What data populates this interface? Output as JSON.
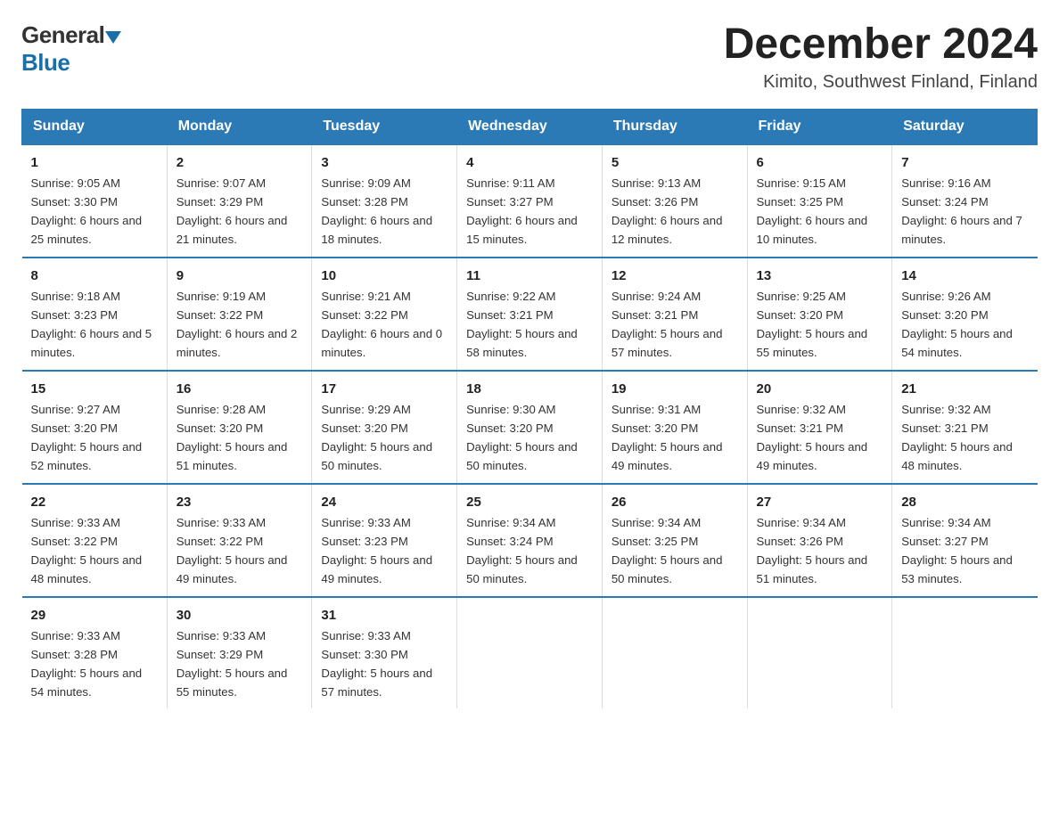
{
  "header": {
    "logo_general": "General",
    "logo_blue": "Blue",
    "title": "December 2024",
    "subtitle": "Kimito, Southwest Finland, Finland"
  },
  "days_of_week": [
    "Sunday",
    "Monday",
    "Tuesday",
    "Wednesday",
    "Thursday",
    "Friday",
    "Saturday"
  ],
  "weeks": [
    [
      {
        "num": "1",
        "sunrise": "9:05 AM",
        "sunset": "3:30 PM",
        "daylight": "6 hours and 25 minutes."
      },
      {
        "num": "2",
        "sunrise": "9:07 AM",
        "sunset": "3:29 PM",
        "daylight": "6 hours and 21 minutes."
      },
      {
        "num": "3",
        "sunrise": "9:09 AM",
        "sunset": "3:28 PM",
        "daylight": "6 hours and 18 minutes."
      },
      {
        "num": "4",
        "sunrise": "9:11 AM",
        "sunset": "3:27 PM",
        "daylight": "6 hours and 15 minutes."
      },
      {
        "num": "5",
        "sunrise": "9:13 AM",
        "sunset": "3:26 PM",
        "daylight": "6 hours and 12 minutes."
      },
      {
        "num": "6",
        "sunrise": "9:15 AM",
        "sunset": "3:25 PM",
        "daylight": "6 hours and 10 minutes."
      },
      {
        "num": "7",
        "sunrise": "9:16 AM",
        "sunset": "3:24 PM",
        "daylight": "6 hours and 7 minutes."
      }
    ],
    [
      {
        "num": "8",
        "sunrise": "9:18 AM",
        "sunset": "3:23 PM",
        "daylight": "6 hours and 5 minutes."
      },
      {
        "num": "9",
        "sunrise": "9:19 AM",
        "sunset": "3:22 PM",
        "daylight": "6 hours and 2 minutes."
      },
      {
        "num": "10",
        "sunrise": "9:21 AM",
        "sunset": "3:22 PM",
        "daylight": "6 hours and 0 minutes."
      },
      {
        "num": "11",
        "sunrise": "9:22 AM",
        "sunset": "3:21 PM",
        "daylight": "5 hours and 58 minutes."
      },
      {
        "num": "12",
        "sunrise": "9:24 AM",
        "sunset": "3:21 PM",
        "daylight": "5 hours and 57 minutes."
      },
      {
        "num": "13",
        "sunrise": "9:25 AM",
        "sunset": "3:20 PM",
        "daylight": "5 hours and 55 minutes."
      },
      {
        "num": "14",
        "sunrise": "9:26 AM",
        "sunset": "3:20 PM",
        "daylight": "5 hours and 54 minutes."
      }
    ],
    [
      {
        "num": "15",
        "sunrise": "9:27 AM",
        "sunset": "3:20 PM",
        "daylight": "5 hours and 52 minutes."
      },
      {
        "num": "16",
        "sunrise": "9:28 AM",
        "sunset": "3:20 PM",
        "daylight": "5 hours and 51 minutes."
      },
      {
        "num": "17",
        "sunrise": "9:29 AM",
        "sunset": "3:20 PM",
        "daylight": "5 hours and 50 minutes."
      },
      {
        "num": "18",
        "sunrise": "9:30 AM",
        "sunset": "3:20 PM",
        "daylight": "5 hours and 50 minutes."
      },
      {
        "num": "19",
        "sunrise": "9:31 AM",
        "sunset": "3:20 PM",
        "daylight": "5 hours and 49 minutes."
      },
      {
        "num": "20",
        "sunrise": "9:32 AM",
        "sunset": "3:21 PM",
        "daylight": "5 hours and 49 minutes."
      },
      {
        "num": "21",
        "sunrise": "9:32 AM",
        "sunset": "3:21 PM",
        "daylight": "5 hours and 48 minutes."
      }
    ],
    [
      {
        "num": "22",
        "sunrise": "9:33 AM",
        "sunset": "3:22 PM",
        "daylight": "5 hours and 48 minutes."
      },
      {
        "num": "23",
        "sunrise": "9:33 AM",
        "sunset": "3:22 PM",
        "daylight": "5 hours and 49 minutes."
      },
      {
        "num": "24",
        "sunrise": "9:33 AM",
        "sunset": "3:23 PM",
        "daylight": "5 hours and 49 minutes."
      },
      {
        "num": "25",
        "sunrise": "9:34 AM",
        "sunset": "3:24 PM",
        "daylight": "5 hours and 50 minutes."
      },
      {
        "num": "26",
        "sunrise": "9:34 AM",
        "sunset": "3:25 PM",
        "daylight": "5 hours and 50 minutes."
      },
      {
        "num": "27",
        "sunrise": "9:34 AM",
        "sunset": "3:26 PM",
        "daylight": "5 hours and 51 minutes."
      },
      {
        "num": "28",
        "sunrise": "9:34 AM",
        "sunset": "3:27 PM",
        "daylight": "5 hours and 53 minutes."
      }
    ],
    [
      {
        "num": "29",
        "sunrise": "9:33 AM",
        "sunset": "3:28 PM",
        "daylight": "5 hours and 54 minutes."
      },
      {
        "num": "30",
        "sunrise": "9:33 AM",
        "sunset": "3:29 PM",
        "daylight": "5 hours and 55 minutes."
      },
      {
        "num": "31",
        "sunrise": "9:33 AM",
        "sunset": "3:30 PM",
        "daylight": "5 hours and 57 minutes."
      },
      null,
      null,
      null,
      null
    ]
  ]
}
